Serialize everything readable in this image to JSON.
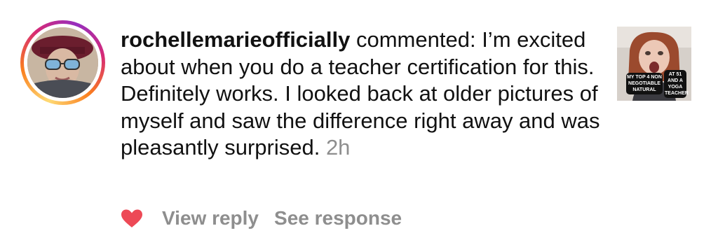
{
  "comment": {
    "username": "rochellemarieofficially",
    "verb": " commented: ",
    "text": "I’m excited about when you do a teacher certification for this. Definitely works. I looked back at older pictures of myself and saw the difference right away and was pleasantly surprised. ",
    "time": "2h"
  },
  "thumbnail": {
    "caption_left": "MY TOP 4 NON NEGOTIABLE NATURAL",
    "caption_right": "AT 51 AND A YOGA TEACHER"
  },
  "actions": {
    "view_reply": "View reply",
    "see_response": "See response"
  },
  "colors": {
    "heart": "#ed4956",
    "muted_text": "#8e8e8e",
    "text": "#111111"
  },
  "icons": {
    "like": "heart-icon"
  }
}
